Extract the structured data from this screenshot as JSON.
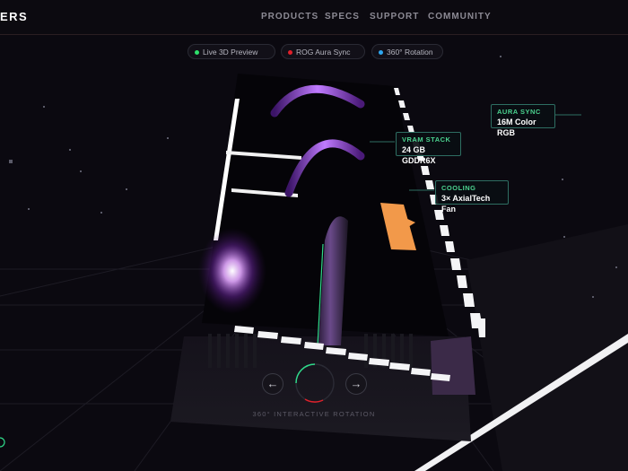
{
  "brand": {
    "partial_name": "ERS"
  },
  "nav": {
    "links": [
      "PRODUCTS",
      "SPECS",
      "SUPPORT",
      "COMMUNITY"
    ]
  },
  "badges": [
    {
      "label": "Live 3D Preview",
      "color": "#2ee06b"
    },
    {
      "label": "ROG Aura Sync",
      "color": "#e0202a"
    },
    {
      "label": "360° Rotation",
      "color": "#2ea7f0"
    }
  ],
  "callouts": {
    "aura": {
      "key": "AURA SYNC",
      "value": "16M Color RGB"
    },
    "vram": {
      "key": "VRAM STACK",
      "value": "24 GB GDDR6X"
    },
    "cooling": {
      "key": "COOLING",
      "value": "3× AxialTech Fan"
    }
  },
  "controls": {
    "prev_icon": "arrow-left-icon",
    "prev_glyph": "←",
    "next_icon": "arrow-right-icon",
    "next_glyph": "→",
    "rotation_label": "360° INTERACTIVE ROTATION"
  },
  "colors": {
    "accent_green": "#4bd28f",
    "accent_orange": "#f2994a",
    "accent_purple": "#b24dff"
  }
}
